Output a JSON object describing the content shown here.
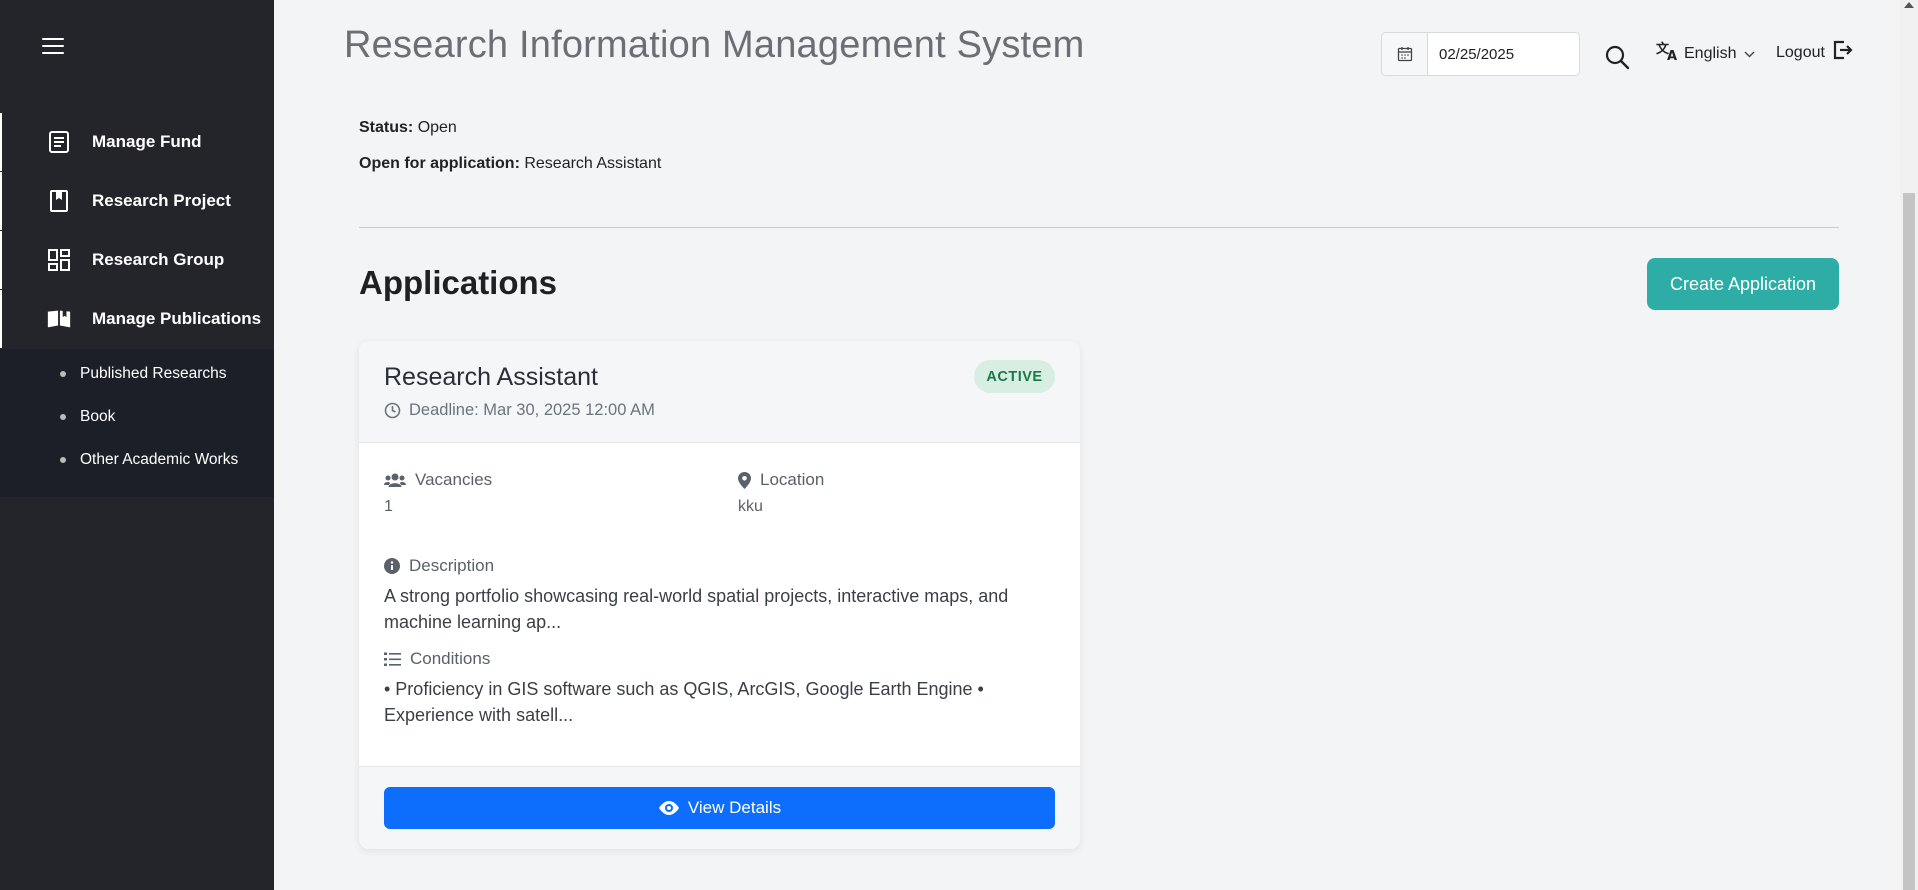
{
  "sidebar": {
    "menu_icon": "hamburger-icon",
    "items": [
      {
        "label": "Manage Fund",
        "icon": "document-list-icon"
      },
      {
        "label": "Research Project",
        "icon": "bookmark-icon"
      },
      {
        "label": "Research Group",
        "icon": "dashboard-grid-icon"
      },
      {
        "label": "Manage Publications",
        "icon": "open-book-icon"
      }
    ],
    "subitems": [
      {
        "label": "Published Researchs"
      },
      {
        "label": "Book"
      },
      {
        "label": "Other Academic Works"
      }
    ]
  },
  "header": {
    "title": "Research Information Management System",
    "date_value": "02/25/2025",
    "language": "English",
    "logout_label": "Logout"
  },
  "details": {
    "status_label": "Status:",
    "status_value": "Open",
    "open_for_label": "Open for application:",
    "open_for_value": "Research Assistant"
  },
  "applications": {
    "section_title": "Applications",
    "create_label": "Create Application",
    "card": {
      "title": "Research Assistant",
      "badge": "ACTIVE",
      "deadline": "Deadline: Mar 30, 2025 12:00 AM",
      "vacancies_label": "Vacancies",
      "vacancies_value": "1",
      "location_label": "Location",
      "location_value": "kku",
      "description_label": "Description",
      "description_text": "A strong portfolio showcasing real-world spatial projects, interactive maps, and machine learning ap...",
      "conditions_label": "Conditions",
      "conditions_text": "• Proficiency in GIS software such as QGIS, ArcGIS, Google Earth Engine • Experience with satell...",
      "view_label": "View Details"
    }
  },
  "colors": {
    "sidebar_bg": "#24242b",
    "accent_teal": "#2eaca6",
    "primary_blue": "#0d6efd",
    "badge_green": "#1a7a45"
  }
}
